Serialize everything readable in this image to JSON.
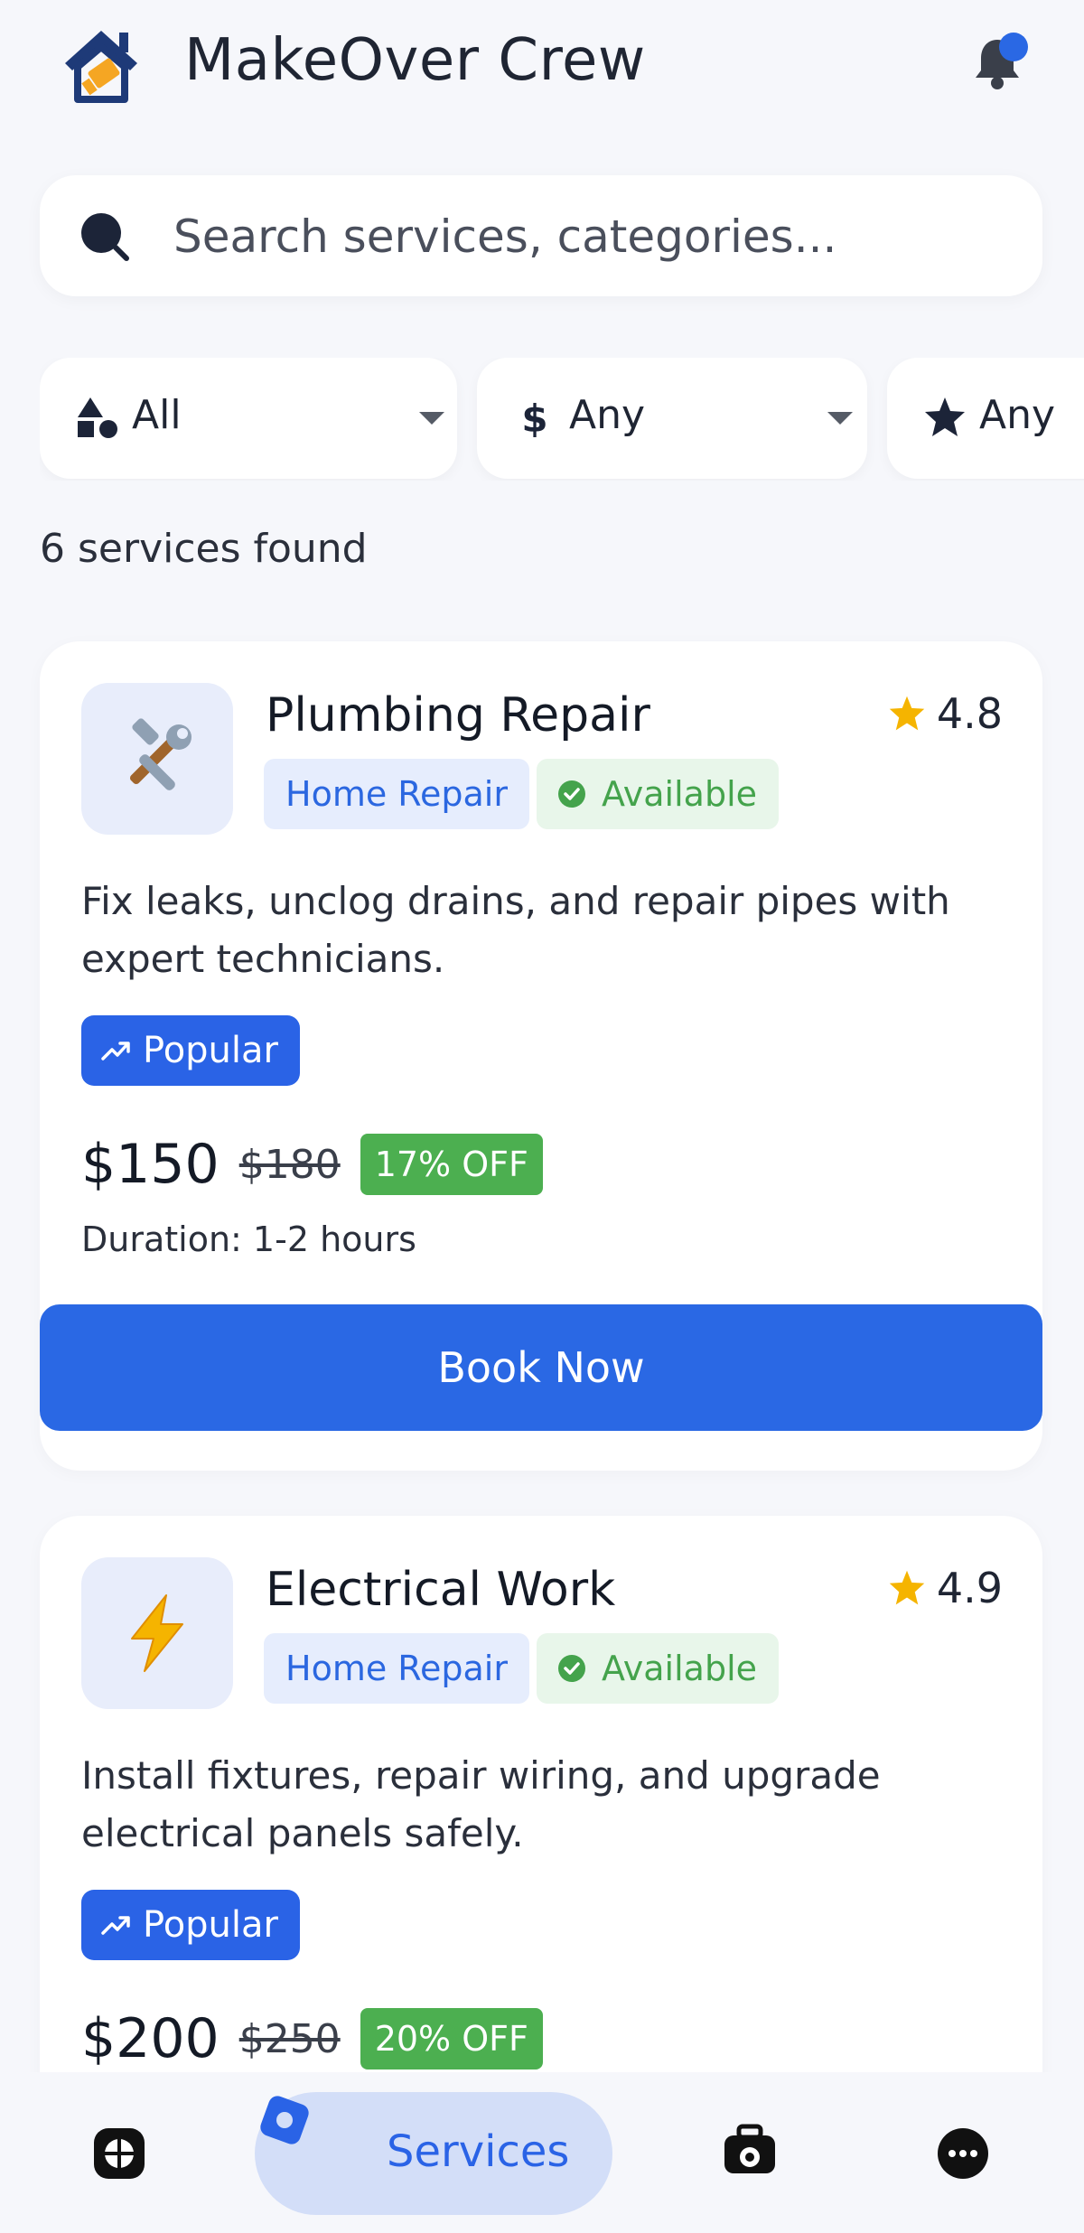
{
  "app": {
    "title": "MakeOver Crew",
    "brand_color": "#2a68e4"
  },
  "search": {
    "placeholder": "Search services, categories..."
  },
  "filters": [
    {
      "icon": "category-icon",
      "label": "All"
    },
    {
      "icon": "dollar-icon",
      "label": "Any"
    },
    {
      "icon": "star-icon",
      "label": "Any"
    }
  ],
  "results": {
    "count_text": "6 services found"
  },
  "services": [
    {
      "title": "Plumbing Repair",
      "icon": "tools-icon",
      "rating": "4.8",
      "category": "Home Repair",
      "availability": "Available",
      "description": "Fix leaks, unclog drains, and repair pipes with expert technicians.",
      "badge": "Popular",
      "price": "$150",
      "old_price": "$180",
      "discount": "17% OFF",
      "duration": "Duration: 1-2 hours",
      "cta": "Book Now"
    },
    {
      "title": "Electrical Work",
      "icon": "lightning-icon",
      "rating": "4.9",
      "category": "Home Repair",
      "availability": "Available",
      "description": "Install fixtures, repair wiring, and upgrade electrical panels safely.",
      "badge": "Popular",
      "price": "$200",
      "old_price": "$250",
      "discount": "20% OFF"
    }
  ],
  "nav": {
    "items": [
      {
        "icon": "home-grid-icon",
        "label": ""
      },
      {
        "icon": "services-icon",
        "label": "Services",
        "active": true
      },
      {
        "icon": "toolbox-icon",
        "label": ""
      },
      {
        "icon": "more-icon",
        "label": ""
      }
    ]
  }
}
